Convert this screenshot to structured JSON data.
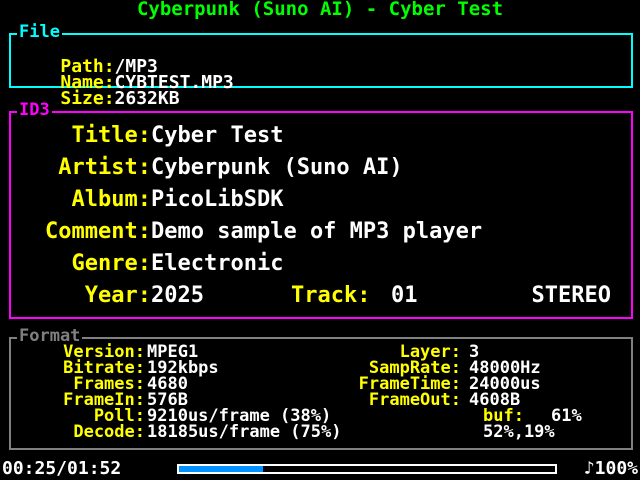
{
  "header": {
    "title": "Cyberpunk (Suno AI) - Cyber Test"
  },
  "file": {
    "section_title": "File",
    "path_label": "Path:",
    "path_value": "/MP3",
    "name_label": "Name:",
    "name_value": "CYBTEST.MP3",
    "size_label": "Size:",
    "size_value": "2632KB"
  },
  "id3": {
    "section_title": "ID3",
    "title_label": "Title:",
    "title_value": "Cyber Test",
    "artist_label": "Artist:",
    "artist_value": "Cyberpunk (Suno AI)",
    "album_label": "Album:",
    "album_value": "PicoLibSDK",
    "comment_label": "Comment:",
    "comment_value": "Demo sample of MP3 player",
    "genre_label": "Genre:",
    "genre_value": "Electronic",
    "year_label": "Year:",
    "year_value": "2025",
    "track_label": "Track:",
    "track_value": "01",
    "channels": "STEREO"
  },
  "format": {
    "section_title": "Format",
    "version_label": "Version:",
    "version_value": "MPEG1",
    "layer_label": "Layer:",
    "layer_value": "3",
    "bitrate_label": "Bitrate:",
    "bitrate_value": "192kbps",
    "samprate_label": "SampRate:",
    "samprate_value": "48000Hz",
    "frames_label": "Frames:",
    "frames_value": "4680",
    "frametime_label": "FrameTime:",
    "frametime_value": "24000us",
    "framein_label": "FrameIn:",
    "framein_value": "576B",
    "frameout_label": "FrameOut:",
    "frameout_value": "4608B",
    "poll_label": "Poll:",
    "poll_value": "9210us/frame (38%)",
    "buf_label": "buf:",
    "buf_value": "61%",
    "decode_label": "Decode:",
    "decode_value": "18185us/frame (75%)",
    "decode_extra": "52%,19%"
  },
  "player": {
    "time": "00:25/01:52",
    "progress_fraction": 0.223,
    "volume_icon": "music-note-icon",
    "volume_glyph": "♪",
    "volume": "100%"
  },
  "colors": {
    "title": "#00FF00",
    "file_border": "#00FFFF",
    "id3_border": "#FF00FF",
    "format_border": "#808080",
    "label": "#FFFF00",
    "value": "#FFFFFF",
    "progress_fill": "#0090FF"
  }
}
